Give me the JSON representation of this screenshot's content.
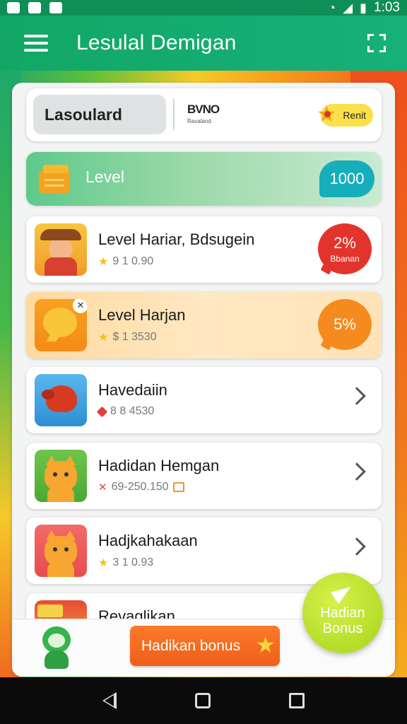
{
  "status_bar": {
    "time": "1:03"
  },
  "app_bar": {
    "title": "Lesulal Demigan"
  },
  "top_card": {
    "field_text": "Lasoulard",
    "logo_main": "BVNO",
    "logo_sub": "Ravaland",
    "badge_label": "Renit"
  },
  "level_bar": {
    "label": "Level",
    "count": "1000"
  },
  "list": [
    {
      "title": "Level Hariar, Bdsugein",
      "sub": "9 1 0.90",
      "sub_icon": "star",
      "badge_pct": "2%",
      "badge_label": "Bbanan",
      "badge_color": "#e3342c"
    },
    {
      "title": "Level Harjan",
      "sub": "$ 1 3530",
      "sub_icon": "star",
      "badge_pct": "5%",
      "badge_color": "#f58a1e"
    },
    {
      "title": "Havedaiin",
      "sub": "8 8 4530",
      "sub_icon": "diamond"
    },
    {
      "title": "Hadidan Hemgan",
      "sub": "69-250.150",
      "sub_icon": "x"
    },
    {
      "title": "Hadjkahakaan",
      "sub": "3 1 0.93",
      "sub_icon": "star"
    },
    {
      "title": "Revaglikan"
    }
  ],
  "bottom": {
    "bonus_button": "Hadikan bonus"
  },
  "fab": {
    "line1": "Hadian",
    "line2": "Bonus"
  },
  "colors": {
    "brand_green": "#12a765",
    "accent_orange": "#ef5f1a",
    "fab_lime": "#b4dd2a"
  },
  "icons": {
    "status_left": [
      "gallery-icon",
      "image-icon",
      "notification-icon"
    ],
    "status_right": [
      "wifi-icon",
      "signal-icon",
      "signal-icon",
      "battery-icon"
    ],
    "menu": "hamburger-menu-icon",
    "action": "scan-frame-icon",
    "level": "treasure-chest-icon",
    "fab": "paper-plane-icon"
  }
}
